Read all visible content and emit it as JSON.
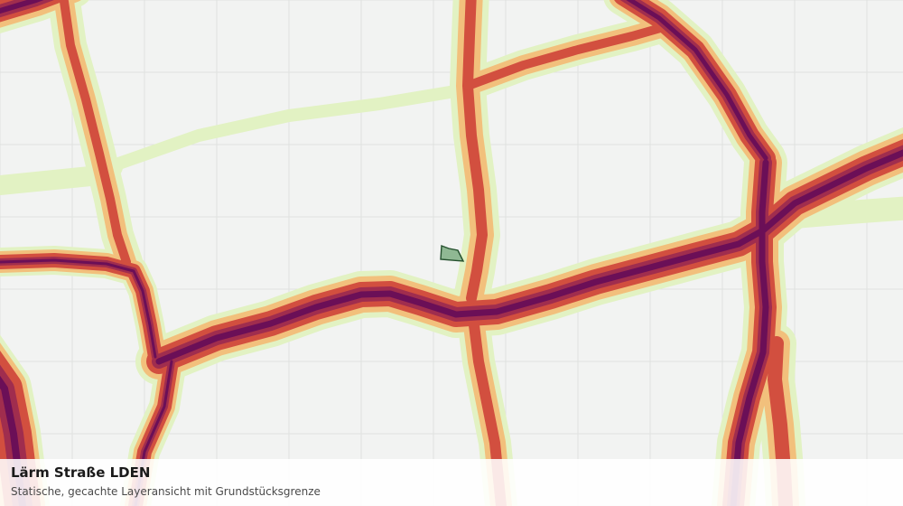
{
  "map": {
    "layer_title": "Lärm Straße LDEN",
    "layer_subtitle": "Statische, gecachte Layeransicht mit Grundstücksgrenze",
    "noise_level_colors": {
      "lowest": "#e2f2c3",
      "low": "#f2c07c",
      "medium": "#d24f3f",
      "high": "#a02d4e",
      "highest": "#6b0f57"
    },
    "parcel_fill": "#8fb893",
    "parcel_stroke": "#24502d",
    "grid_color": "#e0e2e0"
  }
}
